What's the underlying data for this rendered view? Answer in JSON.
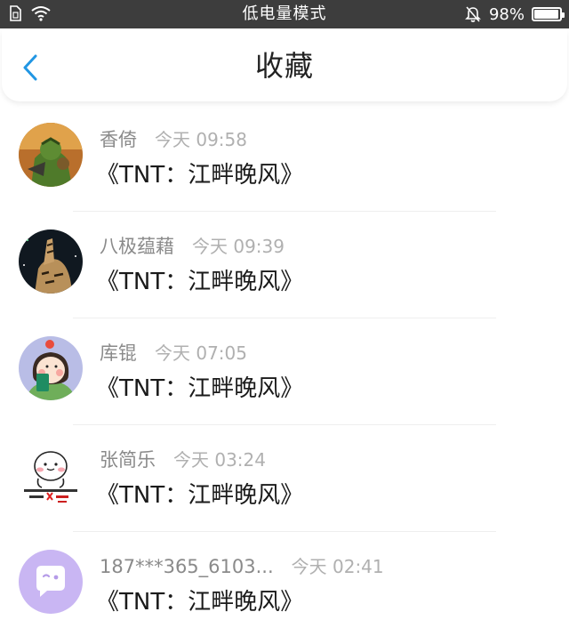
{
  "status_bar": {
    "mode_text": "低电量模式",
    "battery_text": "98%",
    "battery_level": 0.98
  },
  "header": {
    "title": "收藏",
    "back_icon": "chevron-left-icon",
    "accent_color": "#2196e3"
  },
  "items": [
    {
      "name": "香倚",
      "time": "今天 09:58",
      "title": "《TNT：江畔晚风》",
      "avatar": "orc-warrior"
    },
    {
      "name": "八极蕴藉",
      "time": "今天 09:39",
      "title": "《TNT：江畔晚风》",
      "avatar": "tiger"
    },
    {
      "name": "库锟",
      "time": "今天 07:05",
      "title": "《TNT：江畔晚风》",
      "avatar": "girl-cartoon"
    },
    {
      "name": "张简乐",
      "time": "今天 03:24",
      "title": "《TNT：江畔晚风》",
      "avatar": "meme-face"
    },
    {
      "name": "187***365_6103...",
      "time": "今天 02:41",
      "title": "《TNT：江畔晚风》",
      "avatar": "chat-bubble"
    }
  ]
}
